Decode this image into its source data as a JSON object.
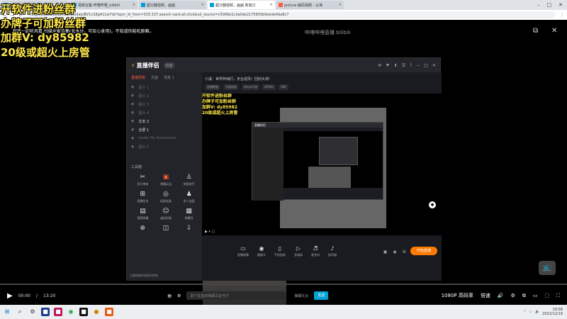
{
  "browser": {
    "tabs": [
      {
        "title": "B站 - 哔哩哔哩",
        "active": false
      },
      {
        "title": "视频合集-哔哩哔哩_bilibili",
        "active": false
      },
      {
        "title": "超分器视频，画面",
        "active": false
      },
      {
        "title": "超分器视频，画面 新窗口",
        "active": true
      },
      {
        "title": "picture 解码视频 - 认准",
        "active": false
      }
    ],
    "url": "https://www.bilibili.com/video/BV1v18g411w7di/?spm_id_from=333.337.search-card.all.click&vd_source=c5006e1c3a0de2175903b9eede4da8c7",
    "window_controls": [
      "–",
      "□",
      "✕"
    ]
  },
  "overlay": {
    "line1": "开软件进粉丝群",
    "line2": "办牌子可加粉丝群",
    "line3": "加群V: dy85982",
    "line4": "20级或超火上房管"
  },
  "danmaku": "和我一起听风看 扫描全家合集(无水分，可安心食用)。不知道你能吃跑嘛。",
  "watermark": "哔哩哔哩直播 bilibili",
  "app": {
    "name": "直播伴侣",
    "badge": "抖音",
    "side_tabs": [
      "直播场景",
      "页面",
      "场景 1"
    ],
    "scenes": [
      {
        "label": "图片 1",
        "bright": false
      },
      {
        "label": "图片 2",
        "bright": false
      },
      {
        "label": "图片 3",
        "bright": false
      },
      {
        "label": "图片 4",
        "bright": false
      },
      {
        "label": "文本 2",
        "bright": true
      },
      {
        "label": "全屏 1",
        "bright": true
      },
      {
        "label": "Inside My Backrooms",
        "bright": false
      },
      {
        "label": "图片 5",
        "bright": false
      }
    ],
    "toolbox_title": "工具箱",
    "tools": [
      {
        "label": "官方审核",
        "icon": "✂",
        "hot": false
      },
      {
        "label": "弹幕玩法",
        "icon": "▣",
        "hot": true
      },
      {
        "label": "房管助手",
        "icon": "♙",
        "hot": false
      },
      {
        "label": "直播任务",
        "icon": "⊞",
        "hot": false
      },
      {
        "label": "投屏连麦",
        "icon": "◎",
        "hot": false
      },
      {
        "label": "多人连麦",
        "icon": "♟",
        "hot": false
      },
      {
        "label": "滚筒屏幕",
        "icon": "▤",
        "hot": false
      },
      {
        "label": "虚拟形象",
        "icon": "☺",
        "hot": false
      },
      {
        "label": "弹幕秀",
        "icon": "▦",
        "hot": false
      },
      {
        "label": "",
        "icon": "⊕",
        "hot": false
      },
      {
        "label": "",
        "icon": "◫",
        "hot": false
      },
      {
        "label": "",
        "icon": "⇩",
        "hot": false
      }
    ],
    "side_footer": "主播直播申请密码审核",
    "live_title": "小溪：世界杯纳们，天台返风！回旧大将!",
    "live_meta": [
      "直播数据",
      "天赋修复",
      "dtsyer3亲",
      "85982",
      "588"
    ],
    "right_top_icons": [
      "✉",
      "⚑",
      "⬆",
      "☰",
      "?",
      "−",
      "□",
      "✕"
    ],
    "nest_text": [
      "开软件进粉丝群",
      "办牌子可加粉丝群",
      "加群V: dy85982",
      "20级或超火上房管"
    ],
    "controls": [
      {
        "label": "直播屏幕",
        "icon": "▭"
      },
      {
        "label": "摄像头",
        "icon": "◉"
      },
      {
        "label": "手机投屏",
        "icon": "▯"
      },
      {
        "label": "多媒体",
        "icon": "▷"
      },
      {
        "label": "麦克风",
        "icon": "♬"
      },
      {
        "label": "扬声器",
        "icon": "♪"
      }
    ],
    "go_live": "开始直播"
  },
  "player": {
    "time_current": "00:00",
    "time_total": "13:20",
    "danmaku_placeholder": "发个友善的弹幕见证当下",
    "danmaku_etiquette": "弹幕礼仪",
    "send": "发送",
    "quality": "1080P 高码率",
    "speed": "倍速"
  },
  "taskbar": {
    "time": "19:58",
    "date": "2022/12/19"
  }
}
